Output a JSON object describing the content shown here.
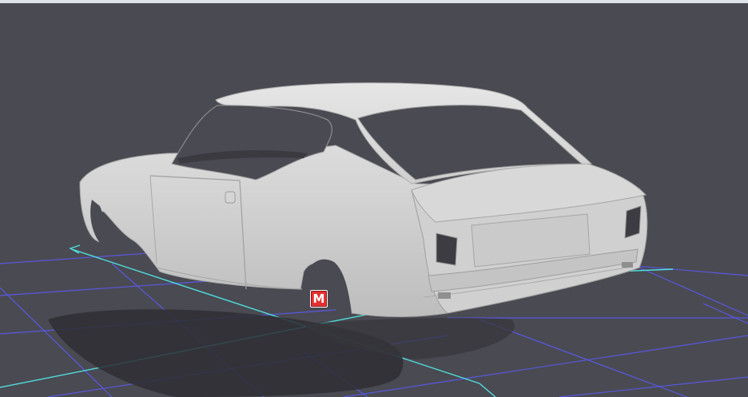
{
  "viewport": {
    "background_color": "#4a4a52",
    "model_body_color": "#c9c9c9",
    "grid_color": "#5a5af0",
    "axis_color": "#4fe0e0"
  },
  "marker": {
    "label": "M",
    "icon": "marker-m-icon",
    "color": "#e53030"
  }
}
